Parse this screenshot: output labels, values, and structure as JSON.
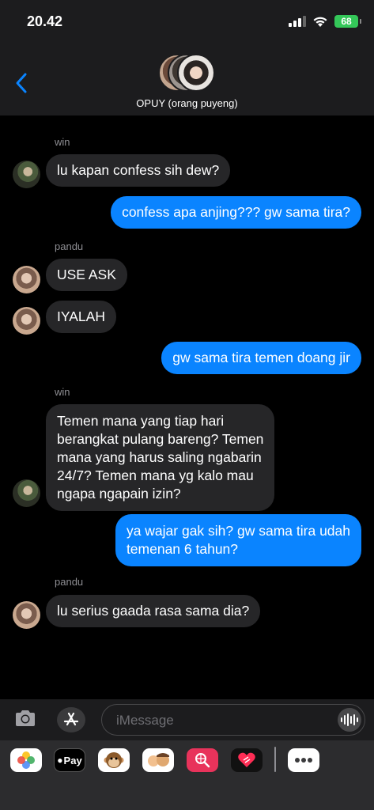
{
  "status": {
    "time": "20.42",
    "battery": "68"
  },
  "header": {
    "group_name": "OPUY (orang puyeng)"
  },
  "messages": [
    {
      "sender": "win"
    },
    {
      "text": "lu kapan confess sih dew?"
    },
    {
      "text": "confess apa anjing??? gw sama tira?"
    },
    {
      "sender": "pandu"
    },
    {
      "text": "USE ASK"
    },
    {
      "text": "IYALAH"
    },
    {
      "text": "gw sama tira temen doang jir"
    },
    {
      "sender": "win"
    },
    {
      "lines": [
        "Temen mana yang tiap hari",
        "berangkat pulang bareng? Temen",
        "mana yang harus saling ngabarin",
        "24/7? Temen mana yg kalo mau",
        "ngapa ngapain izin?"
      ]
    },
    {
      "lines": [
        "ya wajar gak sih? gw sama tira udah",
        "temenan 6 tahun?"
      ]
    },
    {
      "sender": "pandu"
    },
    {
      "text": "lu serius gaada rasa sama dia?"
    }
  ],
  "input": {
    "placeholder": "iMessage"
  },
  "drawer": {
    "apple_pay_label": "Pay"
  },
  "colors": {
    "outgoing": "#0a84ff",
    "incoming": "#262628",
    "battery": "#34c759"
  }
}
